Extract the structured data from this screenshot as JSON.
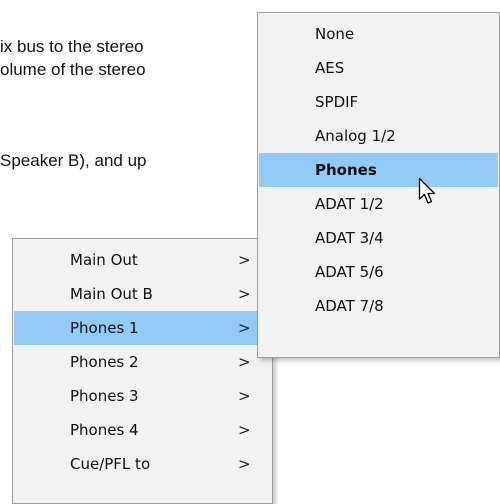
{
  "document": {
    "lines": [
      "ix bus to the stereo",
      "olume of the stereo",
      "Speaker B), and up"
    ]
  },
  "main_menu": {
    "items": [
      {
        "label": "Main Out",
        "arrow": ">"
      },
      {
        "label": "Main Out B",
        "arrow": ">"
      },
      {
        "label": "Phones 1",
        "arrow": ">",
        "selected": true
      },
      {
        "label": "Phones 2",
        "arrow": ">"
      },
      {
        "label": "Phones 3",
        "arrow": ">"
      },
      {
        "label": "Phones 4",
        "arrow": ">"
      },
      {
        "label": "Cue/PFL to",
        "arrow": ">"
      }
    ]
  },
  "sub_menu": {
    "items": [
      {
        "label": "None"
      },
      {
        "label": "AES"
      },
      {
        "label": "SPDIF"
      },
      {
        "label": "Analog 1/2"
      },
      {
        "label": "Phones",
        "selected": true
      },
      {
        "label": "ADAT 1/2"
      },
      {
        "label": "ADAT 3/4"
      },
      {
        "label": "ADAT 5/6"
      },
      {
        "label": "ADAT 7/8"
      }
    ]
  },
  "colors": {
    "menu_background": "#f2f2f2",
    "selection_highlight": "#91c9f7",
    "menu_border": "#a0a0a0"
  },
  "icons": {
    "cursor": "mouse-pointer-arrow-icon",
    "submenu_arrow": "chevron-right-icon"
  }
}
